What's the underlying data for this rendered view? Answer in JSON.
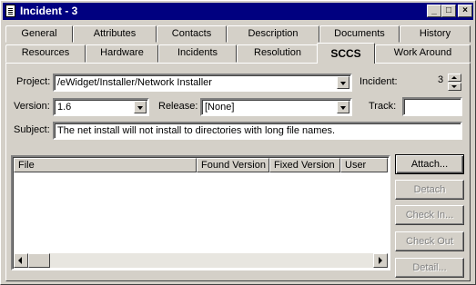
{
  "window": {
    "title": "Incident - 3"
  },
  "titlebar_buttons": {
    "minimize": "_",
    "maximize": "□",
    "close": "×"
  },
  "tabs_row1": [
    "General",
    "Attributes",
    "Contacts",
    "Description",
    "Documents",
    "History"
  ],
  "tabs_row2": [
    "Resources",
    "Hardware",
    "Incidents",
    "Resolution",
    "SCCS",
    "Work Around"
  ],
  "active_tab": "SCCS",
  "form": {
    "project_label": "Project:",
    "project_value": "/eWidget/Installer/Network Installer",
    "incident_label": "Incident:",
    "incident_value": "3",
    "version_label": "Version:",
    "version_value": "1.6",
    "release_label": "Release:",
    "release_value": "[None]",
    "track_label": "Track:",
    "track_value": "",
    "subject_label": "Subject:",
    "subject_value": "The net install will not install to directories with long file names."
  },
  "file_list": {
    "columns": [
      "File",
      "Found Version",
      "Fixed Version",
      "User"
    ],
    "rows": []
  },
  "actions": {
    "attach": "Attach...",
    "detach": "Detach",
    "check_in": "Check In...",
    "check_out": "Check Out",
    "detail": "Detail..."
  }
}
